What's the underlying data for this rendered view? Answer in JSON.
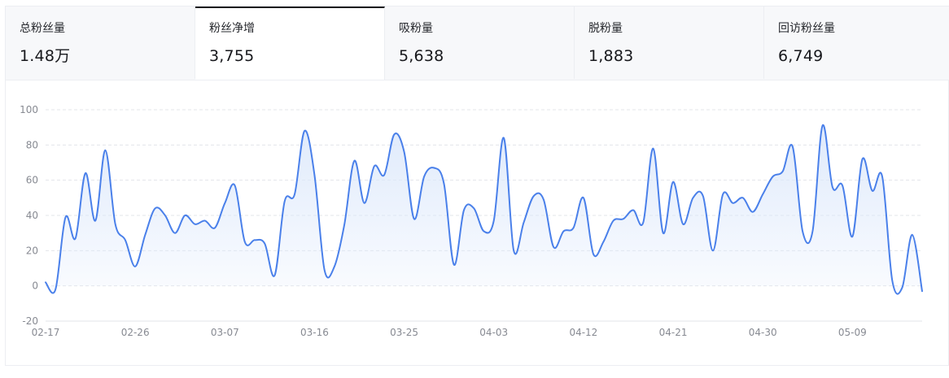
{
  "tabs": [
    {
      "label": "总粉丝量",
      "value": "1.48万",
      "active": false
    },
    {
      "label": "粉丝净增",
      "value": "3,755",
      "active": true
    },
    {
      "label": "吸粉量",
      "value": "5,638",
      "active": false
    },
    {
      "label": "脱粉量",
      "value": "1,883",
      "active": false
    },
    {
      "label": "回访粉丝量",
      "value": "6,749",
      "active": false
    }
  ],
  "colors": {
    "line": "#4a80ea",
    "area_top": "#dce8fb",
    "grid": "#e3e5ea",
    "axis_text": "#878a92"
  },
  "chart_data": {
    "type": "area",
    "title": "",
    "xlabel": "",
    "ylabel": "",
    "ylim": [
      -20,
      100
    ],
    "yticks": [
      100,
      80,
      60,
      40,
      20,
      0,
      -20
    ],
    "xticks": [
      "02-17",
      "02-26",
      "03-07",
      "03-16",
      "03-25",
      "04-03",
      "04-12",
      "04-21",
      "04-30",
      "05-09"
    ],
    "grid": true,
    "x": [
      "02-17",
      "02-18",
      "02-19",
      "02-20",
      "02-21",
      "02-22",
      "02-23",
      "02-24",
      "02-25",
      "02-26",
      "02-27",
      "02-28",
      "03-01",
      "03-02",
      "03-03",
      "03-04",
      "03-05",
      "03-06",
      "03-07",
      "03-08",
      "03-09",
      "03-10",
      "03-11",
      "03-12",
      "03-13",
      "03-14",
      "03-15",
      "03-16",
      "03-17",
      "03-18",
      "03-19",
      "03-20",
      "03-21",
      "03-22",
      "03-23",
      "03-24",
      "03-25",
      "03-26",
      "03-27",
      "03-28",
      "03-29",
      "03-30",
      "03-31",
      "04-01",
      "04-02",
      "04-03",
      "04-04",
      "04-05",
      "04-06",
      "04-07",
      "04-08",
      "04-09",
      "04-10",
      "04-11",
      "04-12",
      "04-13",
      "04-14",
      "04-15",
      "04-16",
      "04-17",
      "04-18",
      "04-19",
      "04-20",
      "04-21",
      "04-22",
      "04-23",
      "04-24",
      "04-25",
      "04-26",
      "04-27",
      "04-28",
      "04-29",
      "04-30",
      "05-01",
      "05-02",
      "05-03",
      "05-04",
      "05-05",
      "05-06",
      "05-07",
      "05-08",
      "05-09",
      "05-10",
      "05-11",
      "05-12",
      "05-13",
      "05-14",
      "05-15",
      "05-16"
    ],
    "series": [
      {
        "values": [
          2,
          -2,
          39,
          27,
          64,
          37,
          77,
          35,
          26,
          11,
          29,
          44,
          40,
          30,
          40,
          35,
          37,
          33,
          47,
          57,
          25,
          26,
          24,
          6,
          48,
          52,
          88,
          63,
          9,
          11,
          35,
          71,
          47,
          68,
          63,
          86,
          76,
          38,
          62,
          67,
          58,
          12,
          43,
          44,
          31,
          37,
          84,
          20,
          36,
          51,
          49,
          22,
          31,
          33,
          50,
          18,
          25,
          37,
          38,
          43,
          36,
          78,
          30,
          59,
          35,
          50,
          51,
          20,
          52,
          47,
          50,
          42,
          52,
          62,
          65,
          79,
          31,
          31,
          91,
          56,
          57,
          28,
          72,
          54,
          62,
          3,
          -1,
          29,
          -3
        ]
      }
    ]
  }
}
